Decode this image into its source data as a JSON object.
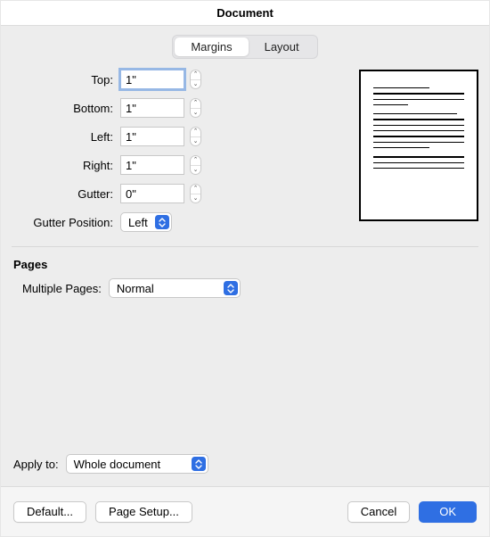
{
  "title": "Document",
  "tabs": {
    "margins": "Margins",
    "layout": "Layout"
  },
  "margins": {
    "top_label": "Top:",
    "top_value": "1\"",
    "bottom_label": "Bottom:",
    "bottom_value": "1\"",
    "left_label": "Left:",
    "left_value": "1\"",
    "right_label": "Right:",
    "right_value": "1\"",
    "gutter_label": "Gutter:",
    "gutter_value": "0\"",
    "gutter_position_label": "Gutter Position:",
    "gutter_position_value": "Left"
  },
  "pages": {
    "heading": "Pages",
    "multiple_label": "Multiple Pages:",
    "multiple_value": "Normal"
  },
  "apply": {
    "label": "Apply to:",
    "value": "Whole document"
  },
  "footer": {
    "default": "Default...",
    "page_setup": "Page Setup...",
    "cancel": "Cancel",
    "ok": "OK"
  }
}
